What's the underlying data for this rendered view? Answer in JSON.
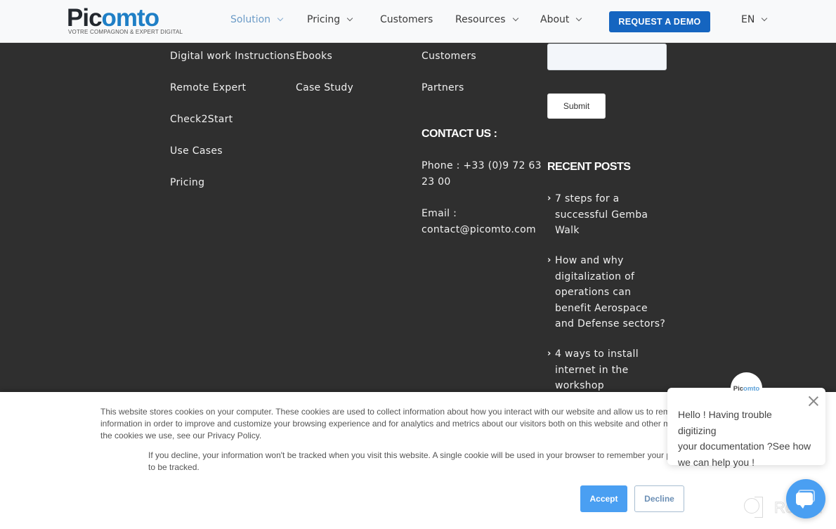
{
  "header": {
    "logo": {
      "word_dark": "Pic",
      "word_blue": "omto",
      "tagline": "VOTRE COMPAGNON & EXPERT DIGITAL"
    },
    "nav": [
      {
        "label": "Solution",
        "dropdown": true,
        "active": true
      },
      {
        "label": "Pricing",
        "dropdown": true,
        "active": false
      },
      {
        "label": "Customers",
        "dropdown": false,
        "active": false
      },
      {
        "label": "Resources",
        "dropdown": true,
        "active": false
      },
      {
        "label": "About",
        "dropdown": true,
        "active": false
      }
    ],
    "cta_label": "REQUEST A DEMO",
    "language": "EN"
  },
  "footer": {
    "solutions": [
      "Digital work Instructions",
      "Remote Expert",
      "Check2Start",
      "Use Cases",
      "Pricing"
    ],
    "resources": [
      "Ebooks",
      "Case Study"
    ],
    "company": [
      "Customers",
      "Partners"
    ],
    "contact": {
      "heading": "CONTACT US :",
      "phone_line1": "Phone : +33 (0)9 72 63",
      "phone_line2": "23 00",
      "email_label": "Email :",
      "email": "contact@picomto.com"
    },
    "newsletter": {
      "input_value": "",
      "submit_label": "Submit"
    },
    "recent_posts": {
      "heading": "RECENT POSTS",
      "items": [
        {
          "lines": [
            "7 steps for a",
            "successful Gemba",
            "Walk"
          ]
        },
        {
          "lines": [
            "How and why",
            "digitalization of",
            "operations can",
            "benefit Aerospace",
            "and Defense sectors?"
          ]
        },
        {
          "lines": [
            "4 ways to install",
            "internet in the",
            "workshop"
          ]
        }
      ]
    }
  },
  "cookie_banner": {
    "text_line1": "This website stores cookies on your computer. These cookies are used to collect information about how you interact with our website and allow us to remember you. We use this",
    "text_line2": "information in order to improve and customize your browsing experience and for analytics and metrics about our visitors both on this website and other media. To find out more about",
    "text_line3": "the cookies we use, see our Privacy Policy.",
    "decline_line1": "If you decline, your information won't be tracked when you visit this website. A single cookie will be used in your browser to remember your preference not",
    "decline_line2": "to be tracked.",
    "accept_label": "Accept",
    "decline_label": "Decline",
    "accent_color": "#4a9ff2"
  },
  "chat": {
    "avatar_dark": "Pic",
    "avatar_blue": "omto",
    "message_line1": "Hello ! Having trouble digitizing",
    "message_line2": "your documentation ?See how",
    "message_line3": "we can help you !"
  },
  "watermark": {
    "text": "Revain"
  }
}
